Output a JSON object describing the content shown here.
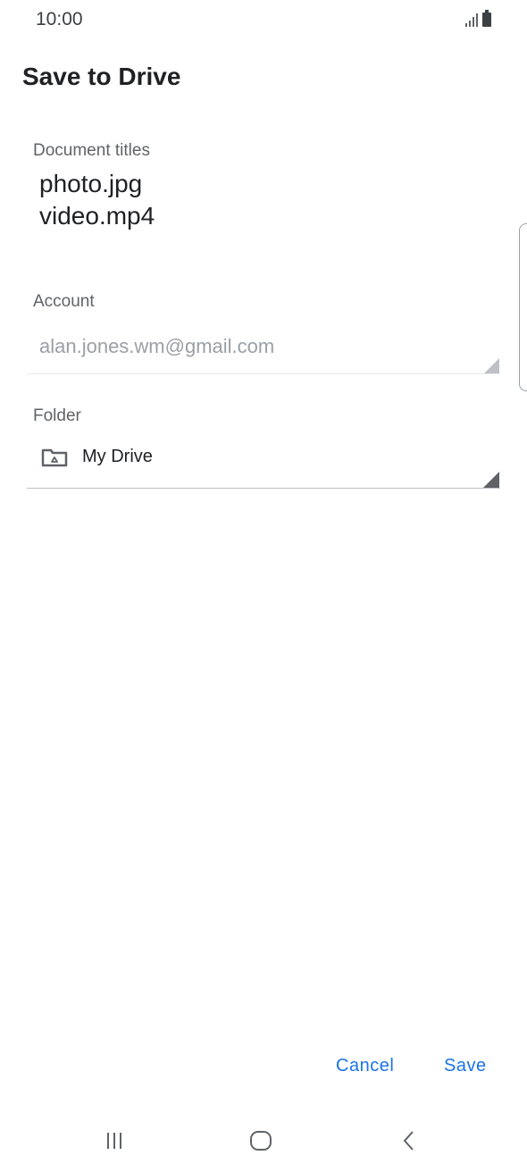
{
  "status_bar": {
    "time": "10:00",
    "icons": [
      "signal-icon",
      "battery-icon"
    ]
  },
  "dialog": {
    "title": "Save to Drive",
    "document_titles": {
      "label": "Document titles",
      "values": [
        "photo.jpg",
        "video.mp4"
      ]
    },
    "account": {
      "label": "Account",
      "value": "alan.jones.wm@gmail.com"
    },
    "folder": {
      "label": "Folder",
      "value": "My Drive",
      "icon": "drive-folder-icon"
    },
    "buttons": {
      "cancel": "Cancel",
      "save": "Save"
    }
  },
  "nav_bar": {
    "icons": [
      "recents-icon",
      "home-icon",
      "back-icon"
    ]
  },
  "colors": {
    "accent": "#1a73e8",
    "label": "#5f6368",
    "disabled_text": "#9aa0a6",
    "text": "#202124"
  }
}
